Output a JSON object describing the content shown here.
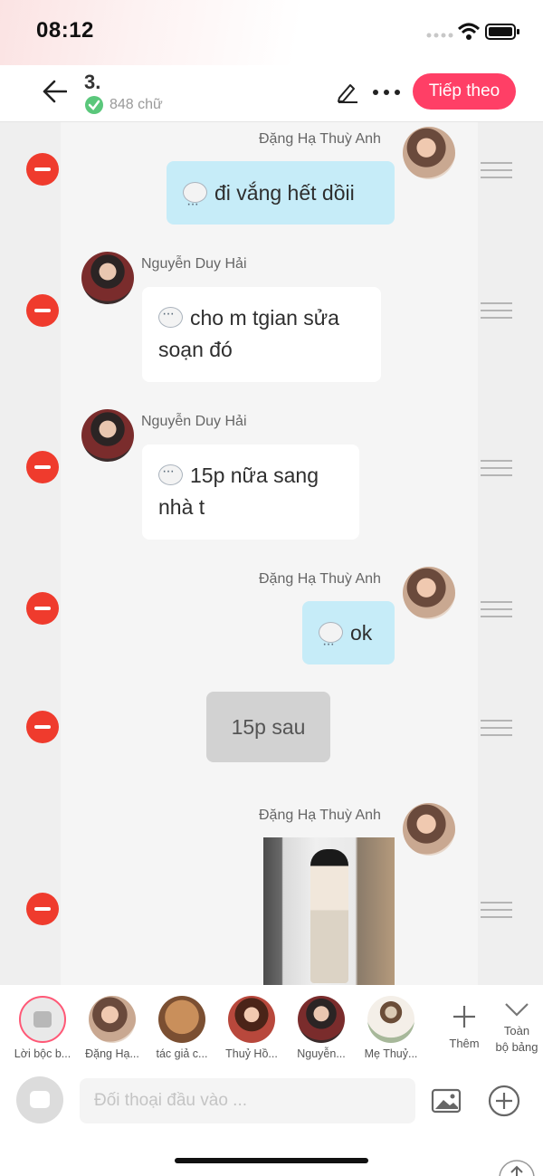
{
  "status_bar": {
    "time": "08:12"
  },
  "header": {
    "title": "3.",
    "word_count": "848 chữ",
    "next_label": "Tiếp theo"
  },
  "messages": [
    {
      "speaker": "Đặng Hạ Thuỳ Anh",
      "side": "right",
      "text": "đi vắng hết dồii"
    },
    {
      "speaker": "Nguyễn Duy Hải",
      "side": "left",
      "lines": [
        "cho m tgian sửa",
        "soạn đó"
      ]
    },
    {
      "speaker": "Nguyễn Duy Hải",
      "side": "left",
      "lines": [
        "15p nữa sang",
        "nhà t"
      ]
    },
    {
      "speaker": "Đặng Hạ Thuỳ Anh",
      "side": "right",
      "text": "ok"
    },
    {
      "type": "narration",
      "text": "15p sau"
    },
    {
      "speaker": "Đặng Hạ Thuỳ Anh",
      "side": "right",
      "type": "image"
    }
  ],
  "characters": [
    {
      "label": "Lời bộc b..."
    },
    {
      "label": "Đặng Hạ..."
    },
    {
      "label": "tác giả c..."
    },
    {
      "label": "Thuỷ Hồ..."
    },
    {
      "label": "Nguyễn..."
    },
    {
      "label": "Mẹ Thuỷ..."
    }
  ],
  "add_char_label": "Thêm",
  "all_board_label": [
    "Toàn",
    "bộ bảng"
  ],
  "input": {
    "placeholder": "Đối thoại đầu vào ..."
  },
  "colors": {
    "accent": "#ff3f66",
    "delete": "#ef3b2d",
    "bubble_right": "#c6ecf8"
  }
}
